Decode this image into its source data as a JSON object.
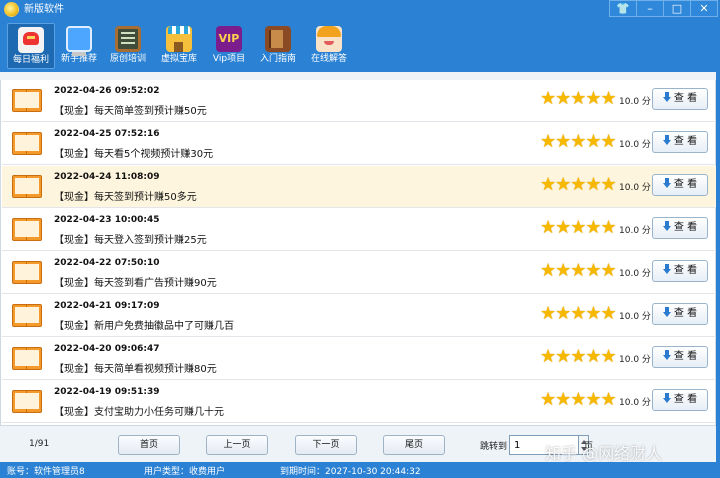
{
  "window": {
    "title": "新版软件",
    "controls": [
      "shirt-icon",
      "minimize-icon",
      "maximize-icon",
      "close-icon"
    ]
  },
  "toolbar": {
    "items": [
      {
        "label": "每日福利",
        "icon": "lucky-cat-icon",
        "active": true
      },
      {
        "label": "新手推荐",
        "icon": "computer-icon"
      },
      {
        "label": "原创培训",
        "icon": "blackboard-icon"
      },
      {
        "label": "虚拟宝库",
        "icon": "shop-icon"
      },
      {
        "label": "Vip项目",
        "icon": "vip-icon"
      },
      {
        "label": "入门指南",
        "icon": "book-icon"
      },
      {
        "label": "在线解答",
        "icon": "support-girl-icon"
      }
    ],
    "vip_text": "VIP"
  },
  "list": {
    "rating_stars": 5,
    "view_label": "查 看",
    "items": [
      {
        "date": "2022-04-26 09:52:02",
        "title": "【现金】每天简单签到预计赚50元",
        "score": "10.0 分"
      },
      {
        "date": "2022-04-25 07:52:16",
        "title": "【现金】每天看5个视频预计赚30元",
        "score": "10.0 分"
      },
      {
        "date": "2022-04-24 11:08:09",
        "title": "【现金】每天签到预计赚50多元",
        "score": "10.0 分"
      },
      {
        "date": "2022-04-23 10:00:45",
        "title": "【现金】每天登入签到预计赚25元",
        "score": "10.0 分"
      },
      {
        "date": "2022-04-22 07:50:10",
        "title": "【现金】每天签到看广告预计赚90元",
        "score": "10.0 分"
      },
      {
        "date": "2022-04-21 09:17:09",
        "title": "【现金】新用户免费抽徽品中了可赚几百",
        "score": "10.0 分"
      },
      {
        "date": "2022-04-20 09:06:47",
        "title": "【现金】每天简单看视频预计赚80元",
        "score": "10.0 分"
      },
      {
        "date": "2022-04-19 09:51:39",
        "title": "【现金】支付宝助力小任务可赚几十元",
        "score": "10.0 分"
      }
    ]
  },
  "pager": {
    "count": "1/91",
    "first": "首页",
    "prev": "上一页",
    "next": "下一页",
    "last": "尾页",
    "jump_label": "跳转到",
    "jump_value": "1",
    "unit": "页"
  },
  "watermark": "知乎 @网络财人",
  "status": {
    "account": "账号：软件管理员8",
    "user_type": "用户类型：收费用户",
    "expiry": "到期时间：2027-10-30 20:44:32"
  },
  "colors": {
    "accent": "#2b82d4",
    "highlight_row": "#fdf5dd",
    "star": "#f7b800"
  }
}
